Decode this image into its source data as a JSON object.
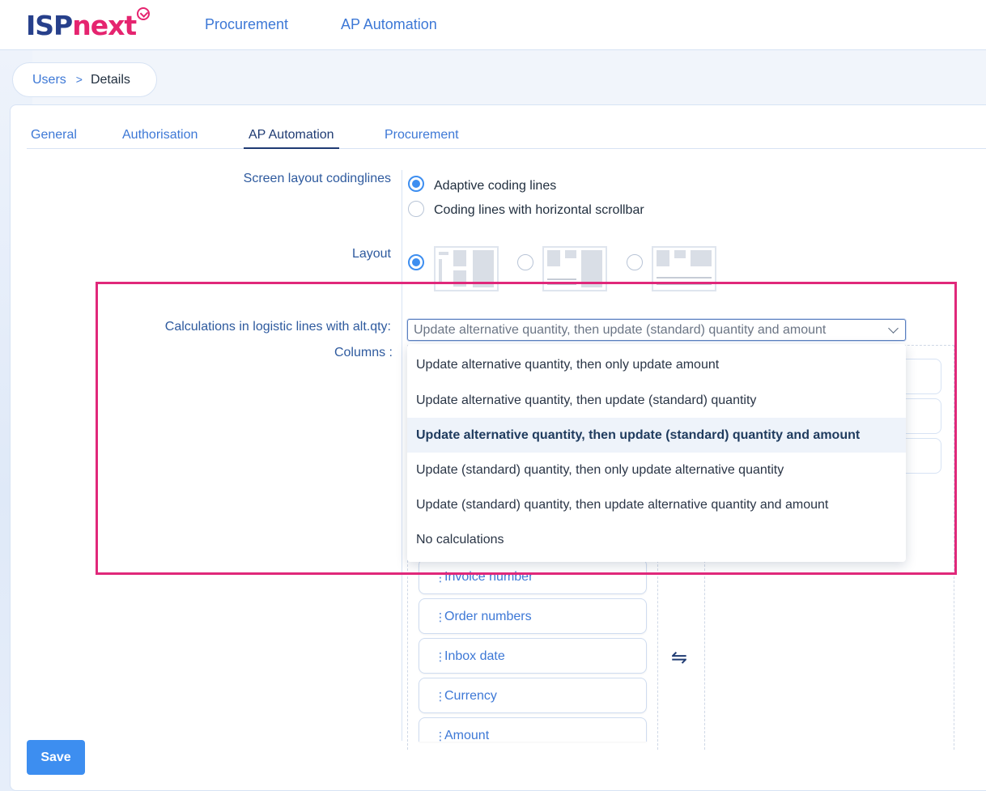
{
  "app": {
    "logo_part1": "ISP",
    "logo_part2": "next",
    "nav": [
      "Procurement",
      "AP Automation"
    ]
  },
  "breadcrumb": {
    "link": "Users",
    "separator": ">",
    "current": "Details"
  },
  "tabs": [
    {
      "label": "General",
      "active": false
    },
    {
      "label": "Authorisation",
      "active": false
    },
    {
      "label": "AP Automation",
      "active": true
    },
    {
      "label": "Procurement",
      "active": false
    }
  ],
  "fields": {
    "screen_layout": {
      "label": "Screen layout codinglines",
      "options": [
        {
          "label": "Adaptive coding lines",
          "checked": true
        },
        {
          "label": "Coding lines with horizontal scrollbar",
          "checked": false
        }
      ]
    },
    "layout": {
      "label": "Layout",
      "selected_index": 0,
      "options_count": 3
    },
    "calculations": {
      "label": "Calculations in logistic lines with alt.qty:",
      "value": "Update alternative quantity, then update (standard) quantity and amount",
      "options": [
        "Update alternative quantity, then only update amount",
        "Update alternative quantity, then update (standard) quantity",
        "Update alternative quantity, then update (standard) quantity and amount",
        "Update (standard) quantity, then only update alternative quantity",
        "Update (standard) quantity, then update alternative quantity and amount",
        "No calculations"
      ],
      "selected_index": 2
    },
    "columns": {
      "label": "Columns :",
      "available": [
        "Invoice number",
        "Order numbers",
        "Inbox date",
        "Currency",
        "Amount"
      ]
    }
  },
  "icons": {
    "grip": "⋮",
    "swap": "⇋"
  },
  "actions": {
    "save_label": "Save"
  },
  "colors": {
    "accent": "#3d8ef0",
    "link": "#3d78d6",
    "brand_dark": "#27408b",
    "brand_pink": "#e5246f",
    "highlight": "#e0287a"
  }
}
